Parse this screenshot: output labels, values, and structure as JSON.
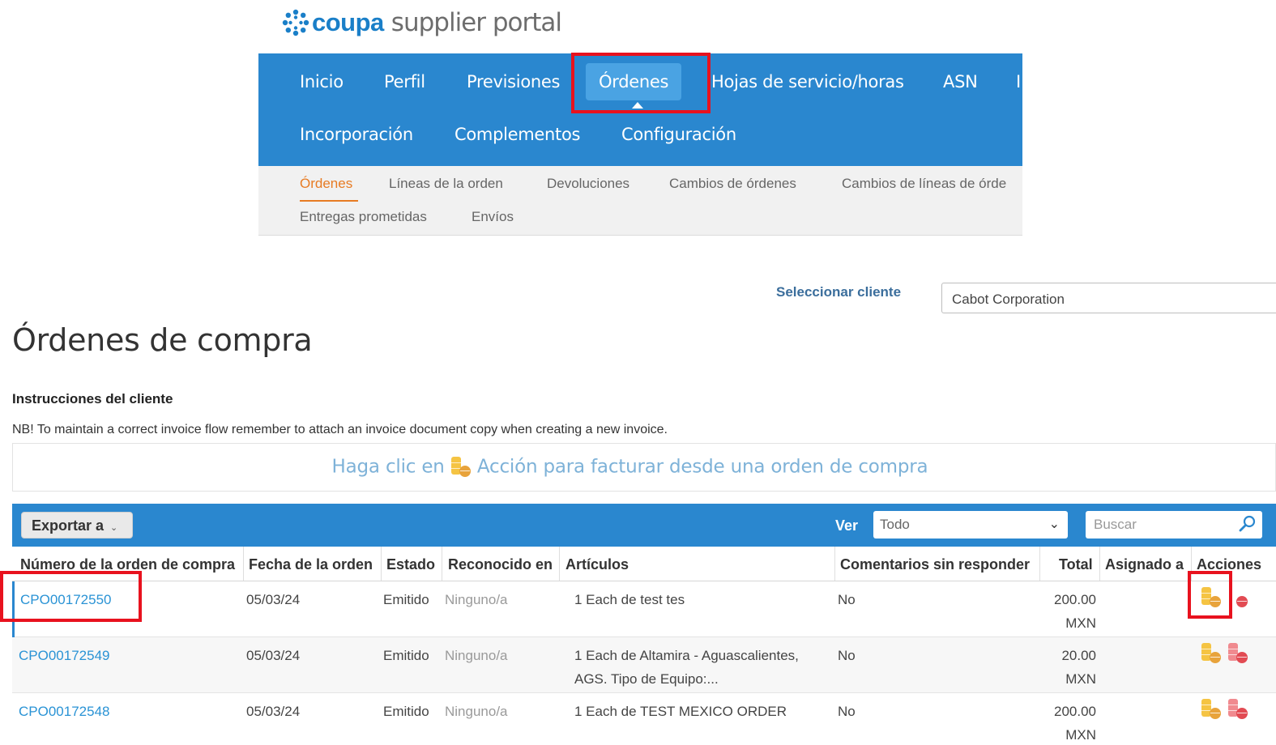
{
  "brand": {
    "name_bold": "coupa",
    "name_rest": "supplier portal"
  },
  "nav": {
    "items": [
      "Inicio",
      "Perfil",
      "Previsiones",
      "Órdenes",
      "Hojas de servicio/horas",
      "ASN",
      "Incorporación",
      "Complementos",
      "Configuración"
    ],
    "active": "Órdenes"
  },
  "subnav": {
    "items": [
      "Órdenes",
      "Líneas de la orden",
      "Devoluciones",
      "Cambios de órdenes",
      "Cambios de líneas de órde",
      "Entregas prometidas",
      "Envíos"
    ],
    "active": "Órdenes"
  },
  "customer": {
    "label": "Seleccionar cliente",
    "value": "Cabot Corporation"
  },
  "page_title": "Órdenes de compra",
  "instructions": {
    "heading": "Instrucciones del cliente",
    "text": "NB! To maintain a correct invoice flow remember to attach an invoice document copy when creating a new invoice."
  },
  "hint": {
    "before": "Haga clic en",
    "after": "Acción para facturar desde una orden de compra"
  },
  "toolbar": {
    "export_label": "Exportar a",
    "view_label": "Ver",
    "view_value": "Todo",
    "search_placeholder": "Buscar"
  },
  "table": {
    "columns": [
      "Número de la orden de compra",
      "Fecha de la orden",
      "Estado",
      "Reconocido en",
      "Artículos",
      "Comentarios sin responder",
      "Total",
      "Asignado a",
      "Acciones"
    ],
    "rows": [
      {
        "po": "CPO00172550",
        "date": "05/03/24",
        "status": "Emitido",
        "ack": "Ninguno/a",
        "items_l1": "1 Each de test tes",
        "items_l2": "",
        "comments": "No",
        "total": "200.00",
        "currency": "MXN",
        "assigned": ""
      },
      {
        "po": "CPO00172549",
        "date": "05/03/24",
        "status": "Emitido",
        "ack": "Ninguno/a",
        "items_l1": "1 Each de Altamira - Aguascalientes,",
        "items_l2": "AGS. Tipo de Equipo:...",
        "comments": "No",
        "total": "20.00",
        "currency": "MXN",
        "assigned": ""
      },
      {
        "po": "CPO00172548",
        "date": "05/03/24",
        "status": "Emitido",
        "ack": "Ninguno/a",
        "items_l1": "1 Each de TEST MEXICO ORDER",
        "items_l2": "",
        "comments": "No",
        "total": "200.00",
        "currency": "MXN",
        "assigned": ""
      }
    ]
  },
  "icons": {
    "invoice_action": "gold-coins-icon",
    "credit_action": "red-coins-icon",
    "search": "search-icon",
    "logo": "coupa-logo-icon"
  },
  "colors": {
    "nav_bg": "#2a87cf",
    "active_tab": "#4aa3e3",
    "highlight": "#e8121e",
    "subnav_active": "#e77b23",
    "link": "#2a93d5"
  }
}
